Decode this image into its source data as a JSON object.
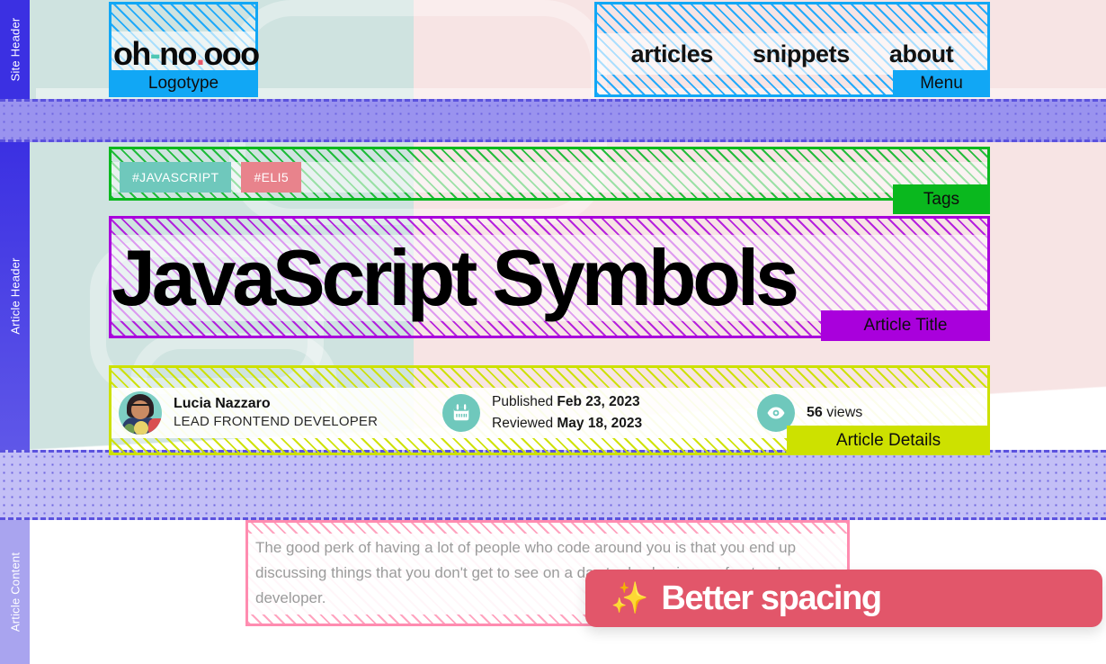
{
  "sidebar": {
    "items": [
      {
        "label": "Site Header"
      },
      {
        "label": "Article Header"
      },
      {
        "label": "Article Content"
      }
    ]
  },
  "site_header": {
    "logo": {
      "part1": "oh",
      "dash": "-",
      "part2": "no",
      "dot": ".",
      "part3": "ooo"
    },
    "logo_annotation": "Logotype",
    "nav": {
      "links": [
        {
          "label": "articles"
        },
        {
          "label": "snippets"
        },
        {
          "label": "about"
        }
      ],
      "annotation": "Menu"
    }
  },
  "article_header": {
    "tags": {
      "annotation": "Tags",
      "items": [
        {
          "label": "#JAVASCRIPT",
          "color": "#6fc8bc"
        },
        {
          "label": "#ELI5",
          "color": "#e8838c"
        }
      ]
    },
    "title": {
      "text": "JavaScript Symbols",
      "annotation": "Article Title"
    },
    "details": {
      "annotation": "Article Details",
      "author": {
        "name": "Lucia Nazzaro",
        "role": "LEAD FRONTEND DEVELOPER",
        "avatar_icon": "avatar-photo"
      },
      "dates": {
        "icon": "calendar-icon",
        "published_label": "Published",
        "published_value": "Feb 23, 2023",
        "reviewed_label": "Reviewed",
        "reviewed_value": "May 18, 2023"
      },
      "views": {
        "icon": "eye-icon",
        "count": "56",
        "label": "views"
      }
    }
  },
  "article_content": {
    "paragraph": "The good perk of having a lot of people who code around you is that you end up discussing things that you don't get to see on a day to day basis as a frontend developer."
  },
  "toast": {
    "icon": "sparkles-icon",
    "message": "Better spacing"
  },
  "colors": {
    "rail": "#3b30e2",
    "spacer": "#9a93ef",
    "blue_outline": "#11a7f5",
    "green_outline": "#0ab81e",
    "purple_outline": "#a900dc",
    "lime_outline": "#cde100",
    "pink_outline": "#ff8cb0",
    "toast_bg": "#e2566a"
  }
}
